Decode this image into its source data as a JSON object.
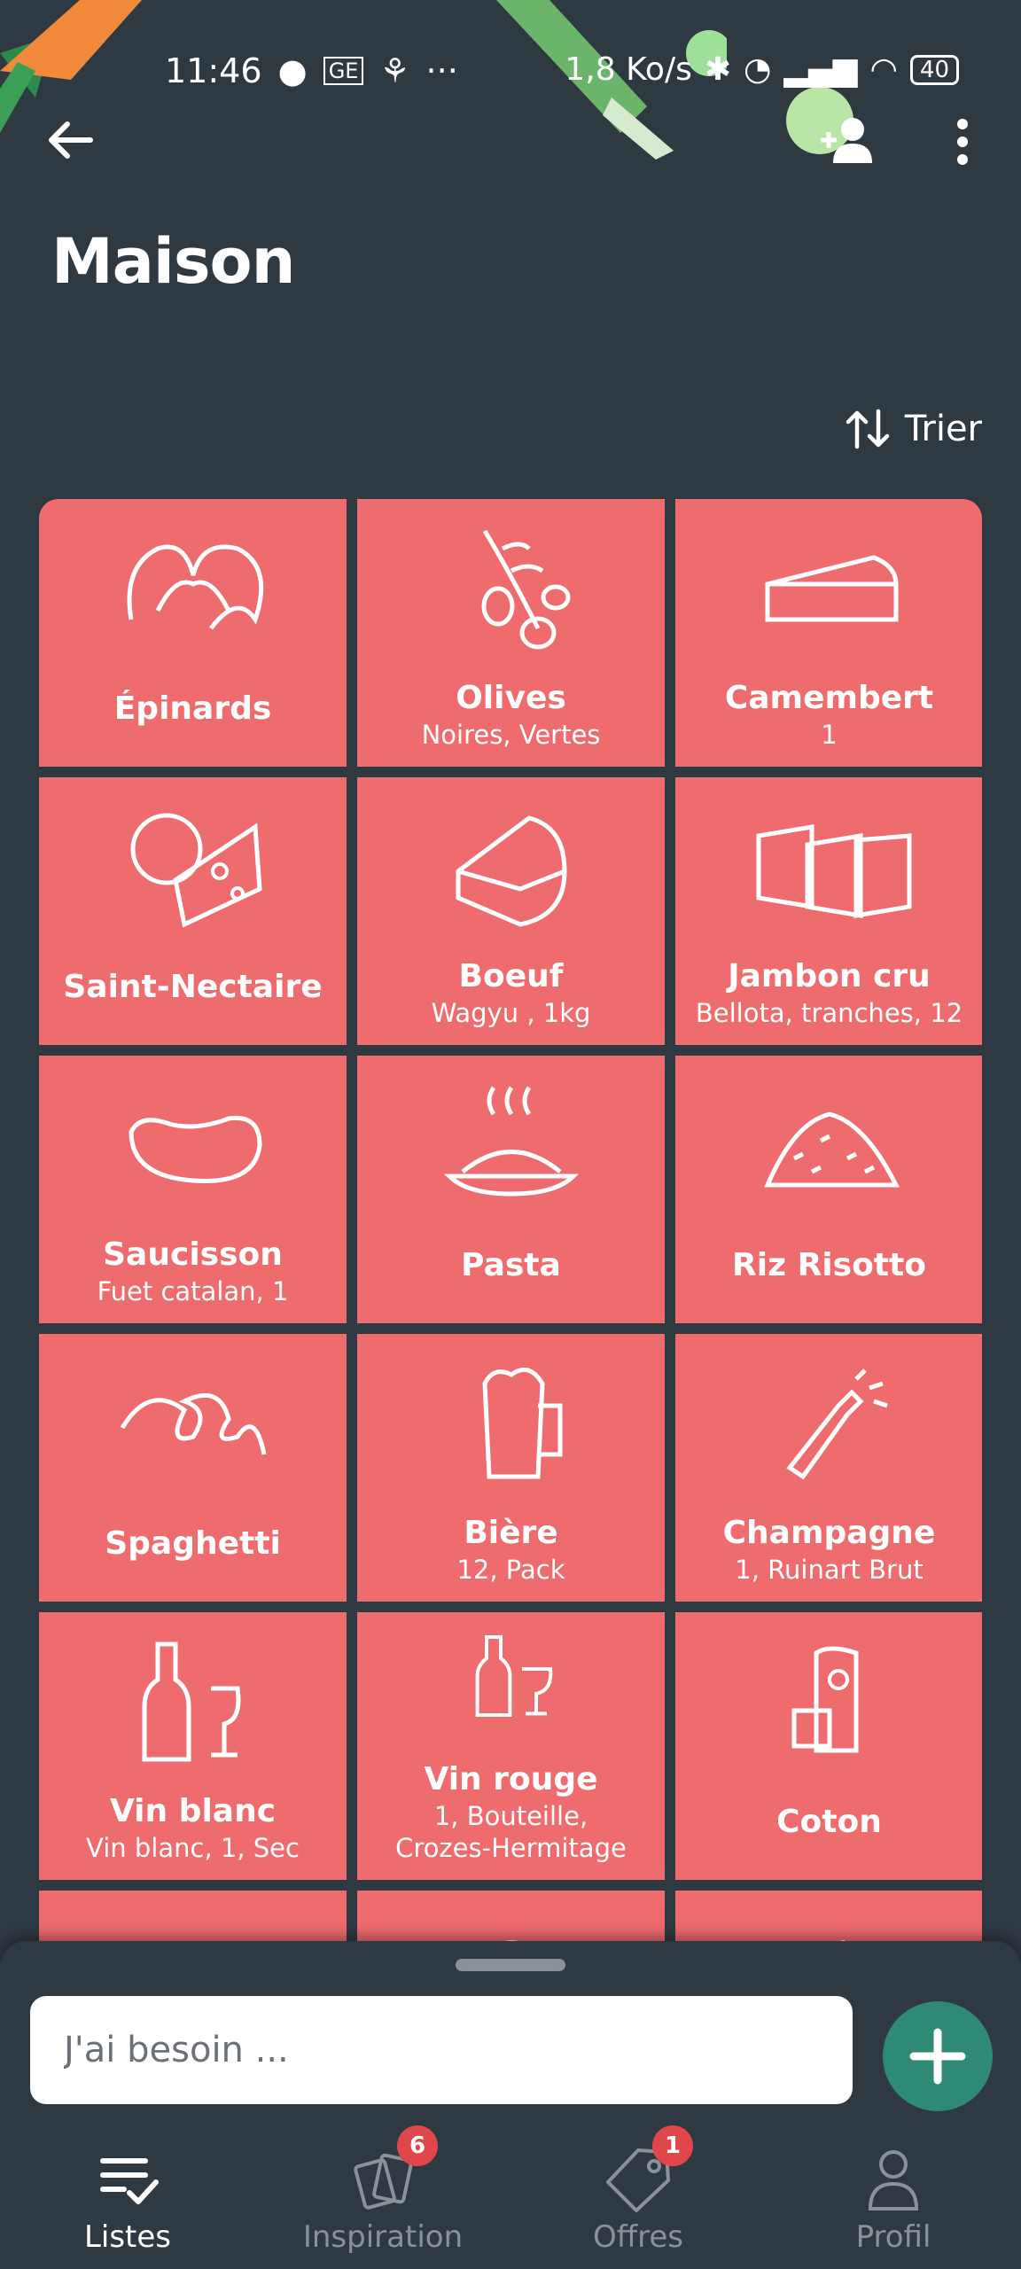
{
  "status": {
    "time": "11:46",
    "network_speed": "1,8 Ko/s",
    "battery": "40",
    "dots": "···"
  },
  "list": {
    "title": "Maison",
    "sort_label": "Trier"
  },
  "tiles": [
    {
      "name": "Épinards",
      "detail": "",
      "icon": "spinach-icon"
    },
    {
      "name": "Olives",
      "detail": "Noires, Vertes",
      "icon": "olives-icon"
    },
    {
      "name": "Camembert",
      "detail": "1",
      "icon": "cheese-wedge-icon"
    },
    {
      "name": "Saint-Nectaire",
      "detail": "",
      "icon": "cheese-icon"
    },
    {
      "name": "Boeuf",
      "detail": "Wagyu , 1kg",
      "icon": "beef-icon"
    },
    {
      "name": "Jambon cru",
      "detail": "Bellota, tranches, 12",
      "icon": "ham-icon"
    },
    {
      "name": "Saucisson",
      "detail": "Fuet catalan, 1",
      "icon": "sausage-icon"
    },
    {
      "name": "Pasta",
      "detail": "",
      "icon": "pasta-icon"
    },
    {
      "name": "Riz Risotto",
      "detail": "",
      "icon": "rice-icon"
    },
    {
      "name": "Spaghetti",
      "detail": "",
      "icon": "spaghetti-icon"
    },
    {
      "name": "Bière",
      "detail": "12, Pack",
      "icon": "beer-icon"
    },
    {
      "name": "Champagne",
      "detail": "1, Ruinart Brut",
      "icon": "champagne-icon"
    },
    {
      "name": "Vin blanc",
      "detail": "Vin blanc, 1, Sec",
      "icon": "white-wine-icon"
    },
    {
      "name": "Vin rouge",
      "detail": "1, Bouteille,\nCrozes-Hermitage",
      "icon": "red-wine-icon"
    },
    {
      "name": "Coton",
      "detail": "",
      "icon": "cotton-icon"
    },
    {
      "name": "",
      "detail": "",
      "icon": "bread-icon"
    },
    {
      "name": "",
      "detail": "",
      "icon": "jar-icon"
    },
    {
      "name": "",
      "detail": "",
      "icon": "carrot-icon"
    }
  ],
  "input": {
    "placeholder": "J'ai besoin ..."
  },
  "nav": {
    "items": [
      {
        "label": "Listes",
        "icon": "list-check-icon",
        "badge": ""
      },
      {
        "label": "Inspiration",
        "icon": "cards-icon",
        "badge": "6"
      },
      {
        "label": "Offres",
        "icon": "tag-icon",
        "badge": "1"
      },
      {
        "label": "Profil",
        "icon": "person-icon",
        "badge": ""
      }
    ]
  },
  "colors": {
    "background": "#2f3942",
    "tile": "#ee6b6e",
    "accent": "#2e8a74",
    "badge": "#e0474c",
    "inactive": "#8a9198"
  }
}
